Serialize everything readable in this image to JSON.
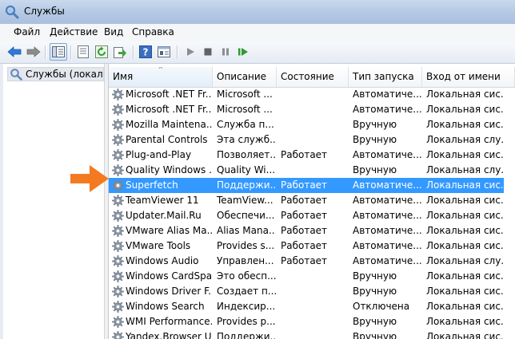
{
  "window": {
    "title": "Службы"
  },
  "menu": [
    {
      "label": "Файл"
    },
    {
      "label": "Действие"
    },
    {
      "label": "Вид"
    },
    {
      "label": "Справка"
    }
  ],
  "tree": {
    "item": "Службы (локальные)"
  },
  "columns": [
    "Имя",
    "Описание",
    "Состояние",
    "Тип запуска",
    "Вход от имени"
  ],
  "rows": [
    {
      "name": "Microsoft .NET Fr...",
      "desc": "Microsoft ...",
      "state": "",
      "startup": "Автоматиче...",
      "logon": "Локальная сис..."
    },
    {
      "name": "Microsoft .NET Fr...",
      "desc": "Microsoft ...",
      "state": "",
      "startup": "Автоматиче...",
      "logon": "Локальная сис..."
    },
    {
      "name": "Mozilla Maintena...",
      "desc": "Служба п...",
      "state": "",
      "startup": "Вручную",
      "logon": "Локальная сис..."
    },
    {
      "name": "Parental Controls",
      "desc": "Эта служб...",
      "state": "",
      "startup": "Вручную",
      "logon": "Локальная слу..."
    },
    {
      "name": "Plug-and-Play",
      "desc": "Позволяет...",
      "state": "Работает",
      "startup": "Автоматиче...",
      "logon": "Локальная сис..."
    },
    {
      "name": "Quality Windows ...",
      "desc": "Quality Wi...",
      "state": "",
      "startup": "Вручную",
      "logon": "Локальная слу..."
    },
    {
      "name": "Superfetch",
      "desc": "Поддержи...",
      "state": "Работает",
      "startup": "Автоматиче...",
      "logon": "Локальная сис..."
    },
    {
      "name": "TeamViewer 11",
      "desc": "TeamView...",
      "state": "Работает",
      "startup": "Автоматиче...",
      "logon": "Локальная сис..."
    },
    {
      "name": "Updater.Mail.Ru",
      "desc": "Обеспечи...",
      "state": "Работает",
      "startup": "Автоматиче...",
      "logon": "Локальная сис..."
    },
    {
      "name": "VMware Alias Ma...",
      "desc": "Alias Mana...",
      "state": "Работает",
      "startup": "Автоматиче...",
      "logon": "Локальная сис..."
    },
    {
      "name": "VMware Tools",
      "desc": "Provides s...",
      "state": "Работает",
      "startup": "Автоматиче...",
      "logon": "Локальная сис..."
    },
    {
      "name": "Windows Audio",
      "desc": "Управлен...",
      "state": "Работает",
      "startup": "Автоматиче...",
      "logon": "Локальная слу..."
    },
    {
      "name": "Windows CardSpa...",
      "desc": "Это обесп...",
      "state": "",
      "startup": "Вручную",
      "logon": "Локальная сис..."
    },
    {
      "name": "Windows Driver F...",
      "desc": "Создает п...",
      "state": "",
      "startup": "Вручную",
      "logon": "Локальная сис..."
    },
    {
      "name": "Windows Search",
      "desc": "Индексир...",
      "state": "",
      "startup": "Отключена",
      "logon": "Локальная сис..."
    },
    {
      "name": "WMI Performance...",
      "desc": "Provides p...",
      "state": "",
      "startup": "Вручную",
      "logon": "Локальная сис..."
    },
    {
      "name": "Yandex.Browser U...",
      "desc": "Поддержи...",
      "state": "",
      "startup": "Вручную",
      "logon": "Локальная сис..."
    }
  ],
  "selected_row": 6,
  "colors": {
    "selection": "#3399ff",
    "arrow": "#f47a20",
    "titlebar": "#b9cde6"
  }
}
